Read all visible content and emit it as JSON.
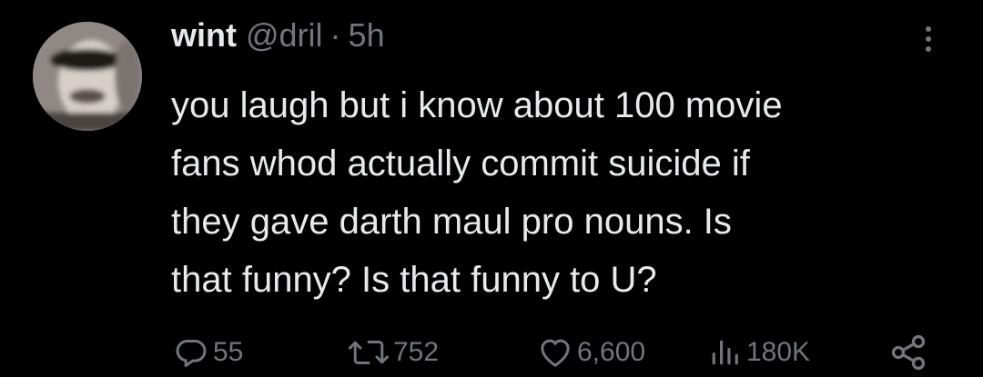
{
  "author": {
    "name": "wint",
    "handle": "@dril",
    "separator": "·",
    "time": "5h"
  },
  "tweet": {
    "lines": [
      "you laugh but i know about 100 movie",
      "fans whod actually commit suicide if",
      "they gave darth maul pro nouns. Is",
      "that funny? Is that funny to U?"
    ]
  },
  "actions": {
    "reply": {
      "icon": "reply-icon",
      "count": "55"
    },
    "retweet": {
      "icon": "retweet-icon",
      "count": "752"
    },
    "like": {
      "icon": "heart-icon",
      "count": "6,600"
    },
    "views": {
      "icon": "views-icon",
      "count": "180K"
    },
    "share": {
      "icon": "share-icon"
    }
  },
  "colors": {
    "background": "#000000",
    "text": "#e7e9ea",
    "muted": "#71767b"
  }
}
